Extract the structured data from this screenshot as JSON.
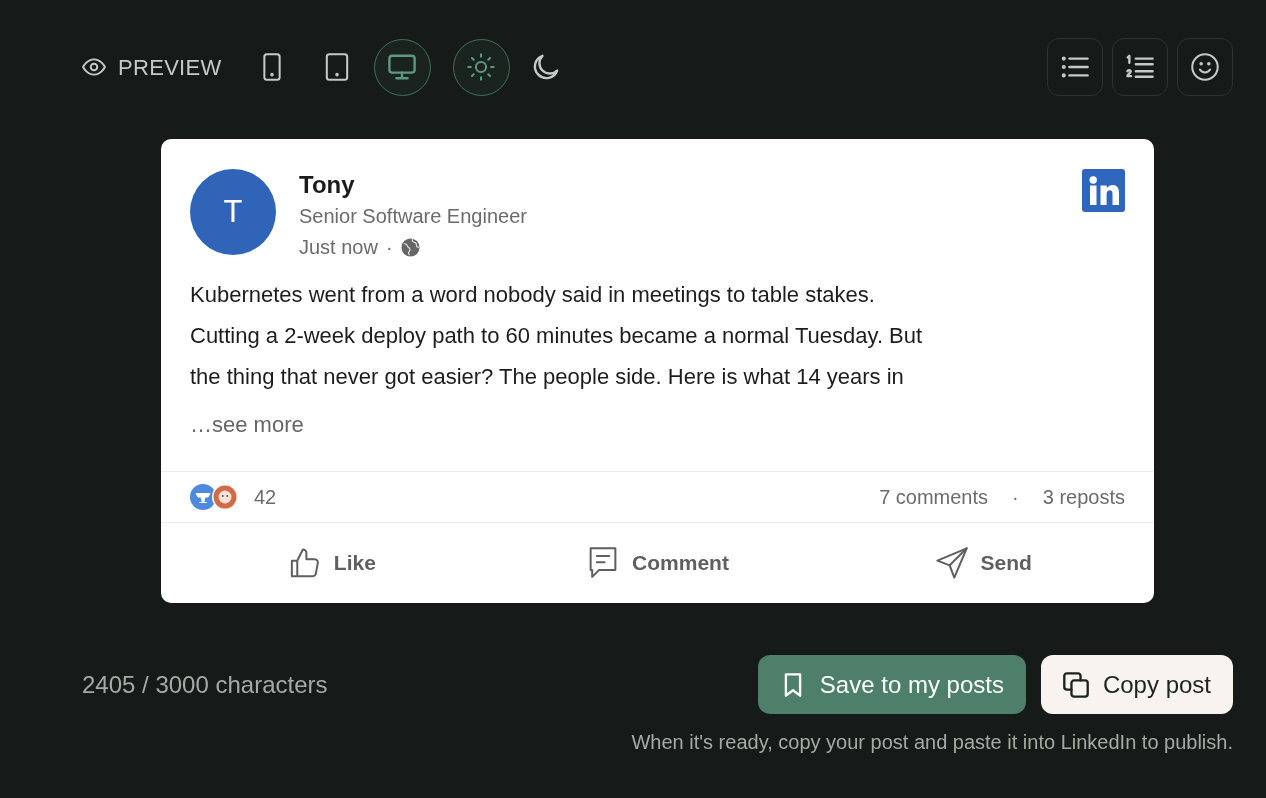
{
  "toolbar": {
    "preview_label": "PREVIEW",
    "devices": [
      {
        "kind": "mobile",
        "selected": false
      },
      {
        "kind": "tablet",
        "selected": false
      },
      {
        "kind": "desktop",
        "selected": true
      }
    ],
    "themes": [
      {
        "kind": "light",
        "selected": true
      },
      {
        "kind": "dark",
        "selected": false
      }
    ],
    "format_buttons": [
      {
        "kind": "bulleted-list"
      },
      {
        "kind": "numbered-list"
      },
      {
        "kind": "emoji"
      }
    ]
  },
  "post": {
    "avatar_initial": "T",
    "author": "Tony",
    "headline": "Senior Software Engineer",
    "time": "Just now",
    "time_separator": "·",
    "body": "Kubernetes went from a word nobody said in meetings to table stakes.\nCutting a 2-week deploy path to 60 minutes became a normal Tuesday. But\nthe thing that never got easier? The people side. Here is what 14 years in",
    "see_more": "…see more",
    "reaction_count": "42",
    "comments": "7 comments",
    "stats_separator": "·",
    "reposts": "3 reposts",
    "actions": [
      {
        "kind": "like",
        "label": "Like"
      },
      {
        "kind": "comment",
        "label": "Comment"
      },
      {
        "kind": "send",
        "label": "Send"
      }
    ]
  },
  "footer": {
    "character_count": "2405 / 3000 characters",
    "buttons": [
      {
        "kind": "save",
        "label": "Save to my posts"
      },
      {
        "kind": "copy",
        "label": "Copy post"
      }
    ],
    "hint": "When it's ready, copy your post and paste it into LinkedIn to publish."
  }
}
